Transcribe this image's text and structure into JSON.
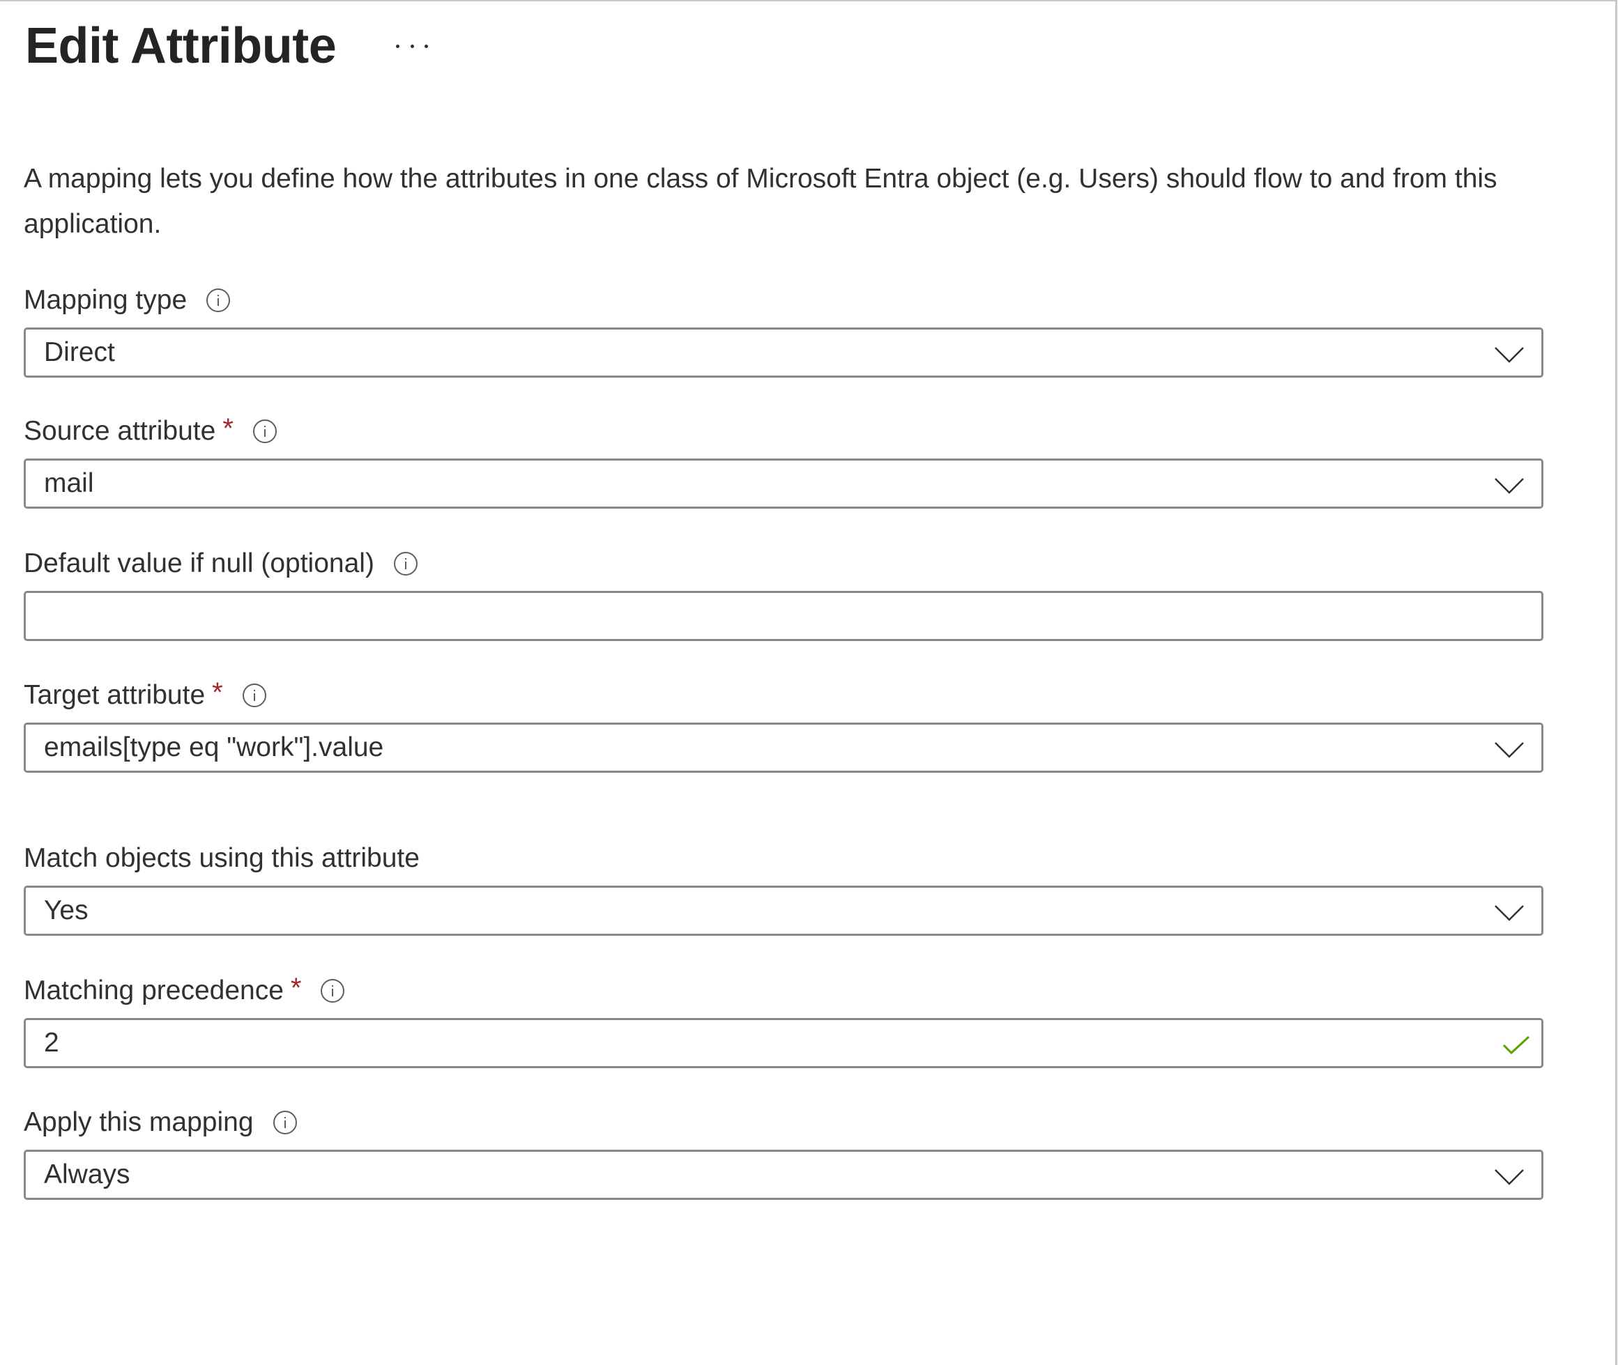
{
  "header": {
    "title": "Edit Attribute",
    "more_icon": "ellipsis-icon"
  },
  "description": "A mapping lets you define how the attributes in one class of Microsoft Entra object (e.g. Users) should flow to and from this application.",
  "fields": {
    "mapping_type": {
      "label": "Mapping type",
      "required": false,
      "info_icon": "info-icon",
      "type": "dropdown",
      "value": "Direct"
    },
    "source_attribute": {
      "label": "Source attribute",
      "required": true,
      "required_marker": "*",
      "info_icon": "info-icon",
      "type": "dropdown",
      "value": "mail"
    },
    "default_value": {
      "label": "Default value if null (optional)",
      "required": false,
      "info_icon": "info-icon",
      "type": "text",
      "value": ""
    },
    "target_attribute": {
      "label": "Target attribute",
      "required": true,
      "required_marker": "*",
      "info_icon": "info-icon",
      "type": "dropdown",
      "value": "emails[type eq \"work\"].value"
    },
    "match_objects": {
      "label": "Match objects using this attribute",
      "required": false,
      "type": "dropdown",
      "value": "Yes"
    },
    "matching_precedence": {
      "label": "Matching precedence",
      "required": true,
      "required_marker": "*",
      "info_icon": "info-icon",
      "type": "text",
      "value": "2",
      "status_icon": "checkmark-icon",
      "valid": true
    },
    "apply_mapping": {
      "label": "Apply this mapping",
      "required": false,
      "info_icon": "info-icon",
      "type": "dropdown",
      "value": "Always"
    }
  },
  "colors": {
    "text": "#323130",
    "required": "#a4262c",
    "field_border": "#8a8886",
    "valid_check": "#57a300"
  }
}
